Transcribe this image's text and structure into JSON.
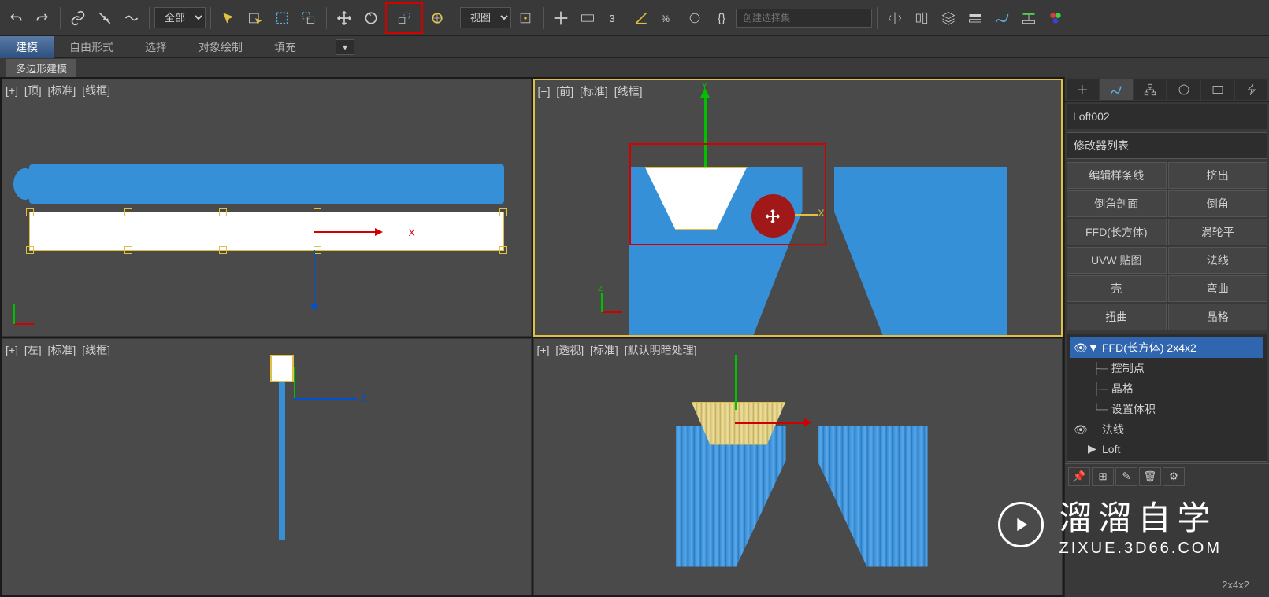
{
  "toolbar": {
    "filter_dropdown": "全部",
    "ref_dropdown": "视图",
    "selection_set_placeholder": "创建选择集"
  },
  "ribbon": {
    "tabs": [
      "建模",
      "自由形式",
      "选择",
      "对象绘制",
      "填充"
    ],
    "active_tab": 0,
    "sub_tab": "多边形建模"
  },
  "viewports": {
    "top": {
      "plus": "[+]",
      "name": "[顶]",
      "standard": "[标准]",
      "mode": "[线框]",
      "x_label": "X"
    },
    "front": {
      "plus": "[+]",
      "name": "[前]",
      "standard": "[标准]",
      "mode": "[线框]",
      "y_label": "Y",
      "x_label": "X",
      "z_label": "Z"
    },
    "left": {
      "plus": "[+]",
      "name": "[左]",
      "standard": "[标准]",
      "mode": "[线框]",
      "z_label": "Z"
    },
    "persp": {
      "plus": "[+]",
      "name": "[透视]",
      "standard": "[标准]",
      "mode": "[默认明暗处理]"
    }
  },
  "panel": {
    "object_name": "Loft002",
    "modifier_list_label": "修改器列表",
    "mod_buttons": [
      [
        "编辑样条线",
        "挤出"
      ],
      [
        "倒角剖面",
        "倒角"
      ],
      [
        "FFD(长方体)",
        "涡轮平"
      ],
      [
        "UVW 贴图",
        "法线"
      ],
      [
        "壳",
        "弯曲"
      ],
      [
        "扭曲",
        "晶格"
      ]
    ],
    "stack": {
      "ffd_item": "FFD(长方体) 2x4x2",
      "children": [
        "控制点",
        "晶格",
        "设置体积"
      ],
      "normals_item": "法线",
      "loft_item": "Loft"
    },
    "footer_coords": "2x4x2"
  },
  "watermark": {
    "title": "溜溜自学",
    "url": "ZIXUE.3D66.COM"
  }
}
